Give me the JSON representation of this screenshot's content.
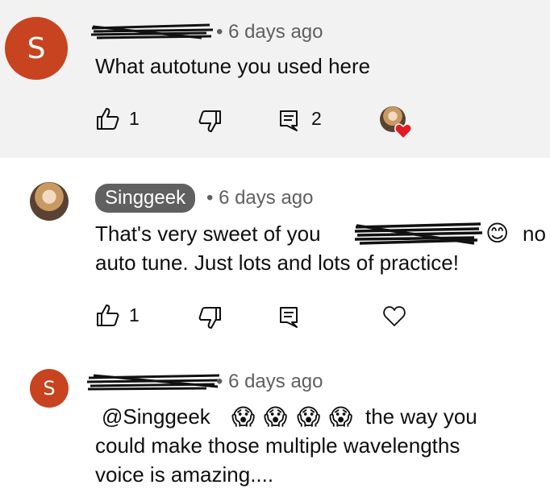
{
  "comments": [
    {
      "avatar_letter": "S",
      "avatar_color": "#c8431f",
      "timestamp": "• 6 days ago",
      "text": "What autotune you used here",
      "likes": "1",
      "replies": "2"
    },
    {
      "author": "Singgeek",
      "timestamp": "• 6 days ago",
      "text_line1_start": "That's very sweet of you",
      "text_line1_end": "no",
      "text_line2": "auto tune. Just lots and lots of practice!",
      "likes": "1",
      "smile_emoji": "😊"
    },
    {
      "avatar_letter": "S",
      "avatar_color": "#c8431f",
      "timestamp": "• 6 days ago",
      "mention": "@Singgeek",
      "scream_emoji": "😱",
      "text_line1_end": "the way you",
      "text_line2": "could make those multiple wavelengths",
      "text_line3": "voice is amazing...."
    }
  ],
  "colors": {
    "highlight_bg": "#f2f2f2",
    "heart_red": "#e41b23",
    "chip_bg": "#606060"
  },
  "icons": [
    "thumb-up-icon",
    "thumb-down-icon",
    "reply-icon",
    "heart-icon",
    "creator-heart-icon"
  ]
}
